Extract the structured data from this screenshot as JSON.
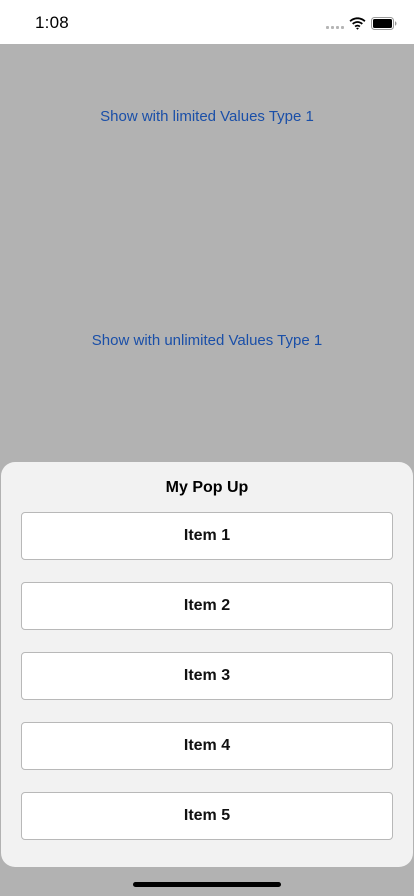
{
  "status_bar": {
    "time": "1:08",
    "icons": [
      "cellular-signal-icon",
      "wifi-icon",
      "battery-icon"
    ]
  },
  "main": {
    "buttons": [
      {
        "label": "Show with limited Values Type 1"
      },
      {
        "label": "Show with unlimited Values Type 1"
      }
    ],
    "link_color": "#1a4fa8",
    "dim_background": "#b2b2b2"
  },
  "popup": {
    "title": "My Pop Up",
    "items": [
      {
        "label": "Item 1"
      },
      {
        "label": "Item 2"
      },
      {
        "label": "Item 3"
      },
      {
        "label": "Item 4"
      },
      {
        "label": "Item 5"
      }
    ]
  }
}
